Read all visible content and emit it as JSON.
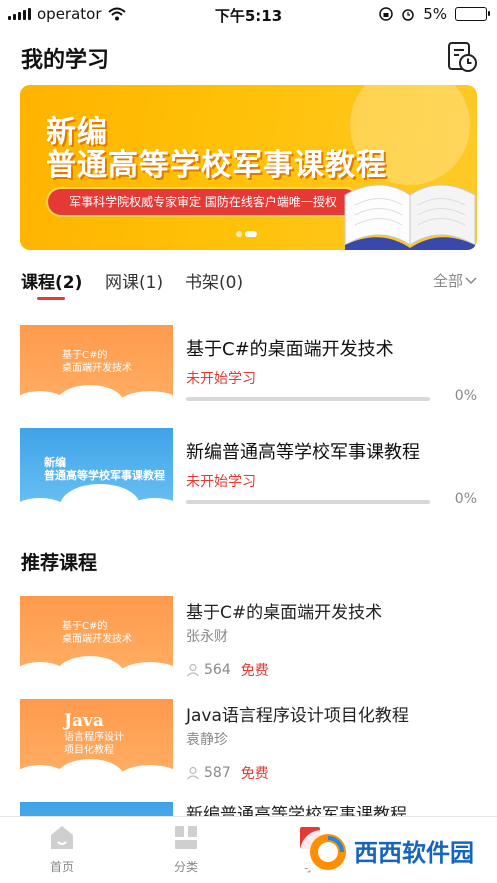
{
  "status_bar": {
    "carrier": "operator",
    "time": "下午5:13",
    "battery": "5%"
  },
  "header": {
    "title": "我的学习",
    "history_icon": "history-icon"
  },
  "banner": {
    "line1": "新编",
    "line2": "普通高等学校军事课教程",
    "tagline": "军事科学院权威专家审定 国防在线客户端唯一授权",
    "active_slide": 2,
    "slide_count": 2
  },
  "tabs": [
    {
      "label": "课程(2)",
      "active": true
    },
    {
      "label": "网课(1)",
      "active": false
    },
    {
      "label": "书架(0)",
      "active": false
    }
  ],
  "filter": {
    "label": "全部"
  },
  "my_courses": [
    {
      "title": "基于C#的桌面端开发技术",
      "status": "未开始学习",
      "progress": 0,
      "progress_label": "0%",
      "thumb_style": "orange",
      "thumb_text": [
        "基于C#的",
        "桌面端开发技术"
      ]
    },
    {
      "title": "新编普通高等学校军事课教程",
      "status": "未开始学习",
      "progress": 0,
      "progress_label": "0%",
      "thumb_style": "blue",
      "thumb_text": [
        "新编",
        "普通高等学校军事课教程"
      ]
    }
  ],
  "recommend": {
    "title": "推荐课程",
    "items": [
      {
        "title": "基于C#的桌面端开发技术",
        "author": "张永财",
        "learners": "564",
        "price": "免费",
        "thumb_text": [
          "基于C#的",
          "桌面端开发技术"
        ]
      },
      {
        "title": "Java语言程序设计项目化教程",
        "author": "袁静珍",
        "learners": "587",
        "price": "免费",
        "thumb_text": [
          "Java",
          "语言程序设计",
          "项目化教程"
        ]
      },
      {
        "title": "新编普通高等学校军事课教程",
        "author": "",
        "learners": "",
        "price": "",
        "thumb_text": []
      }
    ]
  },
  "bottom_nav": [
    {
      "label": "首页",
      "icon": "home-icon"
    },
    {
      "label": "分类",
      "icon": "category-icon"
    },
    {
      "label": "学",
      "icon": "study-icon"
    }
  ],
  "watermark": {
    "text": "西西软件园"
  },
  "colors": {
    "accent": "#e53935",
    "banner_yellow": "#ffc107",
    "thumb_orange": "#ff9a4d",
    "thumb_blue": "#3fa3e8"
  }
}
